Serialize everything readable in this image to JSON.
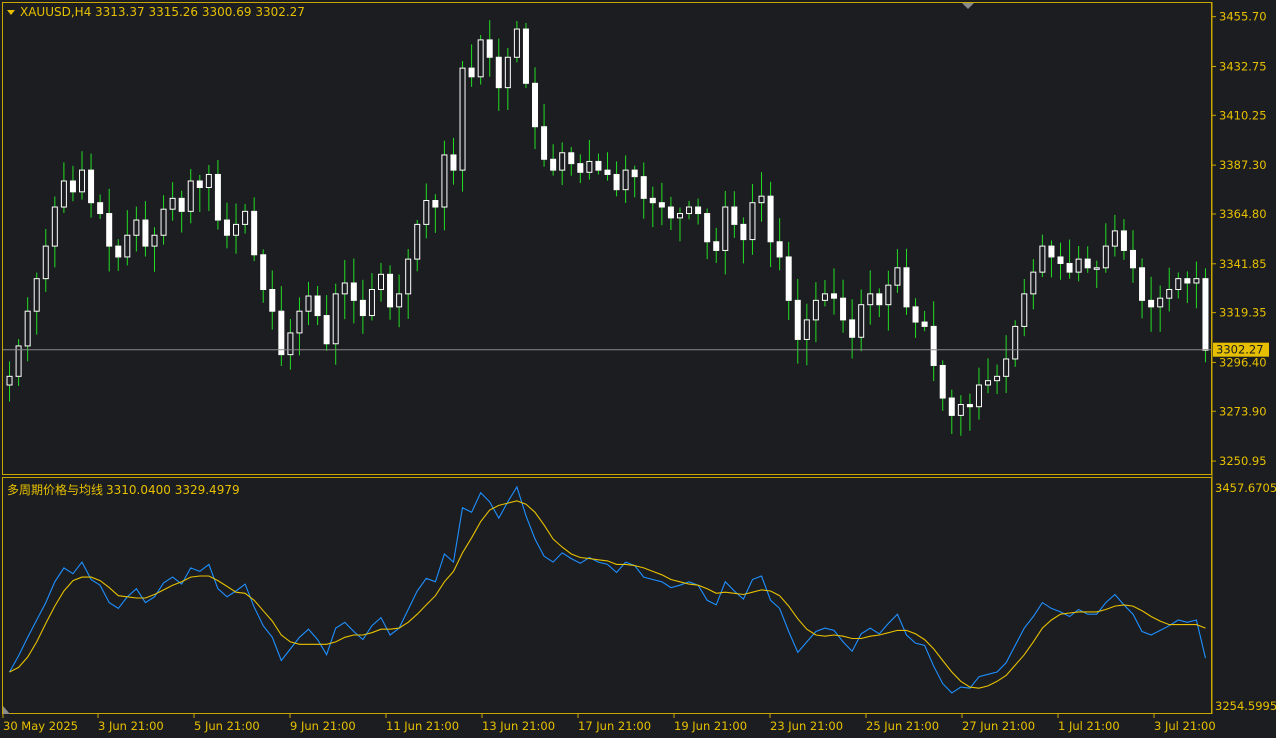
{
  "colors": {
    "background": "#1c1d21",
    "frame": "#c8a800",
    "text": "#e6c000",
    "candle_bull": "#ffffff",
    "candle_bear": "#ffffff",
    "wick": "#22dd22",
    "price_line": "#8a8a8a",
    "price_tag_bg": "#e6c000",
    "fast_line": "#1e90ff",
    "slow_line": "#e6c000"
  },
  "header": {
    "symbol": "XAUUSD,H4",
    "ohlc": "3313.37 3315.26 3300.69 3302.27",
    "menu_icon": "triangle-down-icon"
  },
  "indicator": {
    "name": "多周期价格与均线",
    "values": "3310.0400 3329.4979",
    "top_label": "3457.6705",
    "bottom_label": "3254.5995"
  },
  "current_price": "3302.27",
  "chart_data": [
    {
      "type": "candlestick",
      "title": "XAUUSD,H4",
      "ylim": [
        3245,
        3462
      ],
      "y_ticks": [
        "3455.70",
        "3432.75",
        "3410.25",
        "3387.30",
        "3364.80",
        "3341.85",
        "3319.35",
        "3296.40",
        "3273.90",
        "3250.95"
      ],
      "x_ticks": [
        "30 May 2025",
        "3 Jun 21:00",
        "5 Jun 21:00",
        "9 Jun 21:00",
        "11 Jun 21:00",
        "13 Jun 21:00",
        "17 Jun 21:00",
        "19 Jun 21:00",
        "23 Jun 21:00",
        "25 Jun 21:00",
        "27 Jun 21:00",
        "1 Jul 21:00",
        "3 Jul 21:00"
      ],
      "closes": [
        3290,
        3304,
        3320,
        3335,
        3350,
        3368,
        3380,
        3375,
        3385,
        3370,
        3365,
        3350,
        3345,
        3355,
        3362,
        3350,
        3355,
        3367,
        3372,
        3366,
        3380,
        3377,
        3383,
        3362,
        3355,
        3360,
        3366,
        3346,
        3330,
        3320,
        3300,
        3310,
        3320,
        3327,
        3318,
        3305,
        3328,
        3333,
        3325,
        3318,
        3330,
        3337,
        3322,
        3328,
        3344,
        3360,
        3371,
        3368,
        3392,
        3385,
        3432,
        3428,
        3445,
        3437,
        3423,
        3437,
        3450,
        3425,
        3405,
        3390,
        3385,
        3393,
        3388,
        3384,
        3389,
        3385,
        3383,
        3376,
        3385,
        3382,
        3372,
        3370,
        3368,
        3363,
        3365,
        3368,
        3365,
        3352,
        3348,
        3368,
        3360,
        3353,
        3370,
        3373,
        3352,
        3345,
        3325,
        3307,
        3316,
        3325,
        3328,
        3326,
        3316,
        3308,
        3323,
        3328,
        3323,
        3332,
        3340,
        3322,
        3315,
        3313,
        3295,
        3280,
        3272,
        3277,
        3276,
        3286,
        3288,
        3290,
        3298,
        3313,
        3328,
        3338,
        3350,
        3345,
        3342,
        3338,
        3344,
        3340,
        3340,
        3350,
        3357,
        3348,
        3340,
        3325,
        3322,
        3326,
        3330,
        3335,
        3333,
        3335,
        3302
      ],
      "series_note": "close values estimated from candles"
    },
    {
      "type": "line",
      "title": "多周期价格与均线",
      "ylim": [
        3254.5995,
        3457.6705
      ],
      "series": [
        {
          "values": [
            3290,
            3304,
            3320,
            3335,
            3350,
            3368,
            3380,
            3375,
            3385,
            3370,
            3365,
            3350,
            3345,
            3355,
            3362,
            3350,
            3355,
            3367,
            3372,
            3366,
            3380,
            3377,
            3383,
            3362,
            3355,
            3360,
            3366,
            3346,
            3330,
            3320,
            3300,
            3310,
            3320,
            3327,
            3318,
            3305,
            3328,
            3333,
            3325,
            3318,
            3330,
            3337,
            3322,
            3328,
            3344,
            3360,
            3371,
            3368,
            3392,
            3385,
            3432,
            3428,
            3445,
            3437,
            3423,
            3437,
            3450,
            3425,
            3405,
            3390,
            3385,
            3393,
            3388,
            3384,
            3389,
            3385,
            3383,
            3376,
            3385,
            3382,
            3372,
            3370,
            3368,
            3363,
            3365,
            3368,
            3365,
            3352,
            3348,
            3368,
            3360,
            3353,
            3370,
            3373,
            3352,
            3345,
            3325,
            3307,
            3316,
            3325,
            3328,
            3326,
            3316,
            3308,
            3323,
            3328,
            3323,
            3332,
            3340,
            3322,
            3315,
            3313,
            3295,
            3280,
            3272,
            3277,
            3276,
            3286,
            3288,
            3290,
            3298,
            3313,
            3328,
            3338,
            3350,
            3345,
            3342,
            3338,
            3344,
            3340,
            3340,
            3350,
            3357,
            3348,
            3340,
            3325,
            3322,
            3326,
            3330,
            3335,
            3333,
            3335,
            3302
          ]
        },
        {
          "values": [
            3290,
            3294,
            3303,
            3316,
            3332,
            3347,
            3360,
            3369,
            3372,
            3372,
            3369,
            3363,
            3356,
            3355,
            3354,
            3354,
            3357,
            3361,
            3365,
            3368,
            3372,
            3373,
            3373,
            3369,
            3364,
            3359,
            3358,
            3352,
            3343,
            3334,
            3322,
            3316,
            3314,
            3314,
            3314,
            3314,
            3316,
            3320,
            3322,
            3322,
            3324,
            3327,
            3327,
            3328,
            3333,
            3340,
            3348,
            3356,
            3368,
            3377,
            3393,
            3406,
            3420,
            3430,
            3434,
            3436,
            3438,
            3435,
            3428,
            3417,
            3405,
            3398,
            3392,
            3389,
            3388,
            3387,
            3386,
            3383,
            3383,
            3382,
            3380,
            3377,
            3374,
            3370,
            3368,
            3366,
            3365,
            3362,
            3358,
            3359,
            3358,
            3357,
            3359,
            3361,
            3360,
            3356,
            3347,
            3336,
            3327,
            3322,
            3321,
            3322,
            3321,
            3319,
            3319,
            3321,
            3322,
            3324,
            3326,
            3326,
            3323,
            3318,
            3310,
            3300,
            3290,
            3282,
            3277,
            3276,
            3278,
            3282,
            3287,
            3296,
            3305,
            3316,
            3328,
            3335,
            3340,
            3341,
            3342,
            3342,
            3342,
            3344,
            3347,
            3348,
            3347,
            3343,
            3338,
            3334,
            3331,
            3331,
            3331,
            3331,
            3328
          ]
        }
      ]
    }
  ]
}
